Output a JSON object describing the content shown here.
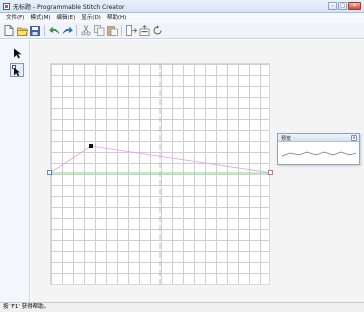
{
  "window": {
    "title": "无标题 - Programmable Stitch Creator",
    "controls": [
      "minimize",
      "maximize",
      "close"
    ]
  },
  "menu": [
    "文件(F)",
    "模式(M)",
    "编辑(E)",
    "显示(D)",
    "帮助(H)"
  ],
  "toolbar": {
    "icons": [
      "new-file-icon",
      "open-folder-icon",
      "save-icon",
      "undo-icon",
      "redo-icon",
      "cut-icon",
      "copy-icon",
      "paste-icon",
      "import-icon",
      "export-icon",
      "rotate-icon"
    ]
  },
  "tools": [
    "select-arrow-icon",
    "point-edit-arrow-icon"
  ],
  "preview": {
    "title": "预览"
  },
  "status": {
    "text": "按 'F1' 获得帮助。"
  },
  "colors": {
    "guide_line": "#7be07b",
    "stitch_line": "#e79de9",
    "accent": "#3a6ebf"
  }
}
